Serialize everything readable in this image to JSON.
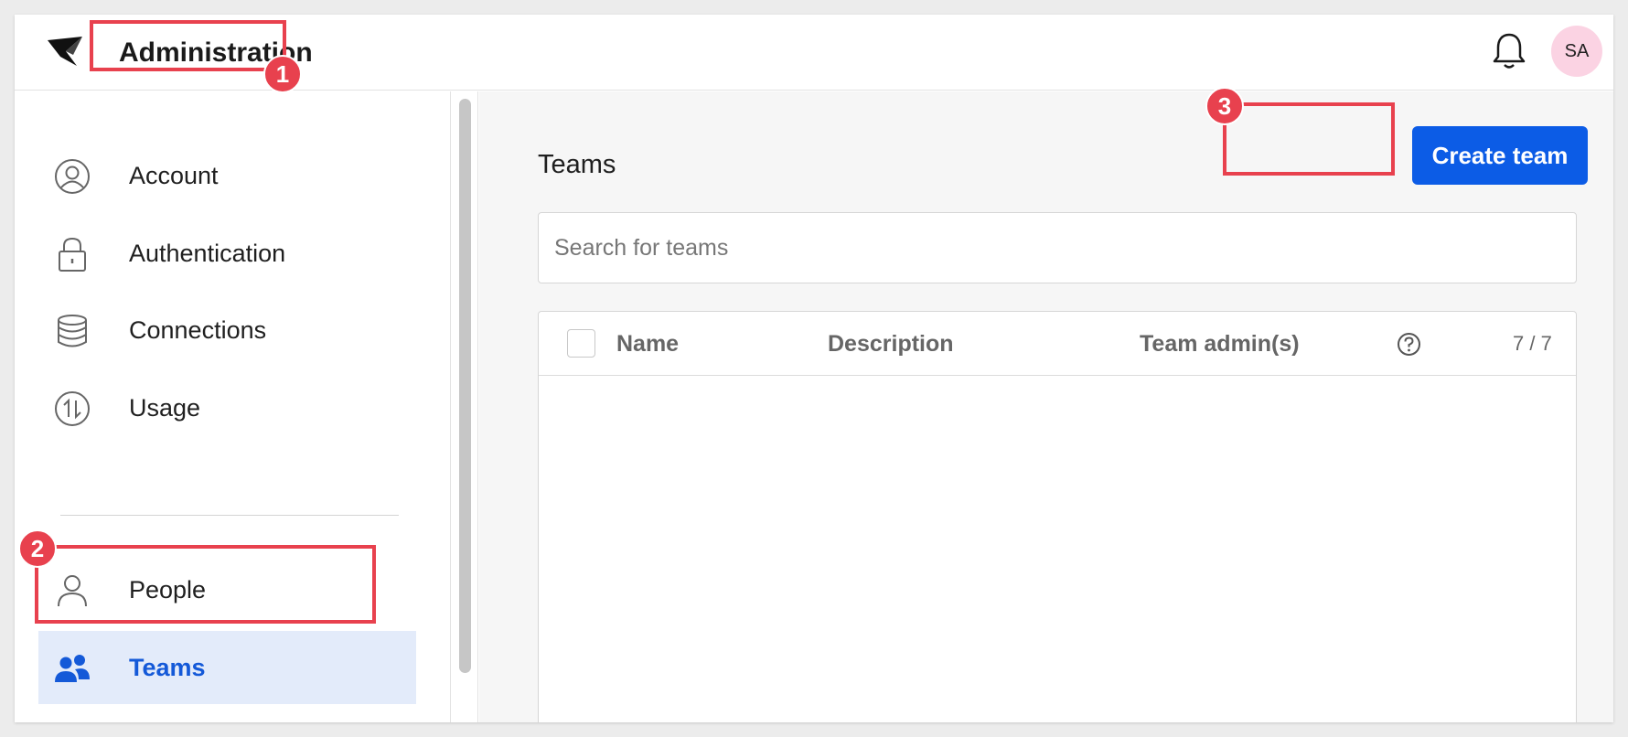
{
  "header": {
    "title": "Administration",
    "logo_icon": "bird-logo-icon",
    "bell_icon": "bell-icon",
    "avatar_initials": "SA",
    "avatar_color": "#fbd3e3"
  },
  "sidebar": {
    "items": [
      {
        "label": "Account",
        "icon": "user-circle-icon"
      },
      {
        "label": "Authentication",
        "icon": "lock-icon"
      },
      {
        "label": "Connections",
        "icon": "database-icon"
      },
      {
        "label": "Usage",
        "icon": "usage-arrows-icon"
      },
      {
        "label": "People",
        "icon": "person-icon"
      },
      {
        "label": "Teams",
        "icon": "team-icon",
        "active": true
      }
    ]
  },
  "main": {
    "title": "Teams",
    "create_button": "Create team",
    "search_placeholder": "Search for teams",
    "table": {
      "columns": [
        "Name",
        "Description",
        "Team admin(s)"
      ],
      "count": "7 / 7"
    }
  },
  "annotations": [
    "1",
    "2",
    "3"
  ],
  "colors": {
    "accent": "#0c5ce6",
    "active_bg": "#e3ebfa",
    "annotation": "#e8414e"
  }
}
